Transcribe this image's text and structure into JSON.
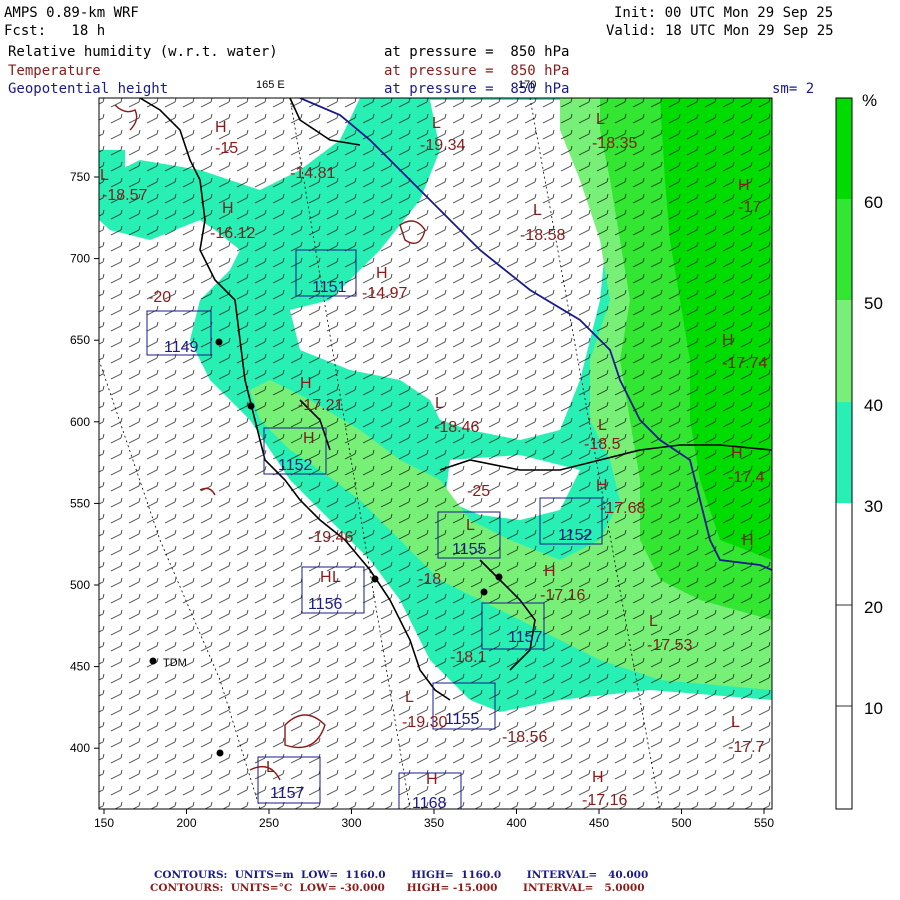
{
  "header": {
    "model": "AMPS 0.89-km WRF",
    "fcst": "Fcst:   18 h",
    "init": "Init: 00 UTC Mon 29 Sep 25",
    "valid": "Valid: 18 UTC Mon 29 Sep 25",
    "rh_label": "Relative humidity (w.r.t. water)",
    "temp_label": "Temperature",
    "geo_label": "Geopotential height",
    "pressure_1": "at pressure =  850 hPa",
    "pressure_2": "at pressure =  850 hPa",
    "pressure_3": "at pressure =  850 hPa",
    "lon_165": "165 E",
    "lon_170": "170",
    "sm": "sm= 2"
  },
  "axes": {
    "x_ticks": [
      "150",
      "200",
      "250",
      "300",
      "350",
      "400",
      "450",
      "500",
      "550"
    ],
    "y_ticks": [
      "750",
      "700",
      "650",
      "600",
      "550",
      "500",
      "450",
      "400"
    ]
  },
  "colorbar": {
    "unit": "%",
    "labels": [
      "60",
      "50",
      "40",
      "30",
      "20",
      "10"
    ],
    "colors": {
      "gt60": "#00dc00",
      "50_60": "#32e632",
      "40_50": "#78f078",
      "30_40": "#28f0b4",
      "lt30": "#ffffff"
    }
  },
  "map_labels": {
    "H_marks": [
      "H",
      "H",
      "H",
      "H",
      "H",
      "H",
      "H",
      "H",
      "H",
      "H",
      "H",
      "H",
      "H",
      "H"
    ],
    "L_marks": [
      "L",
      "L",
      "L",
      "L",
      "L",
      "L",
      "L",
      "L",
      "L",
      "L",
      "L",
      "L"
    ],
    "temps": [
      "-15",
      "-14.81",
      "-16.12",
      "-19.34",
      "-18.35",
      "-18.58",
      "-17",
      "-14.97",
      "-17.21",
      "-18.46",
      "-18.5",
      "-17.74",
      "-17.4",
      "-17.68",
      "-19.46",
      "-17.16",
      "-17.53",
      "-19.30",
      "-18.56",
      "-17.7",
      "-17.16",
      "-18.57",
      "-20",
      "-25",
      "-18",
      "-18.1"
    ],
    "heights": [
      "1151",
      "1149",
      "1152",
      "1155",
      "1152",
      "1156",
      "1157",
      "1155",
      "1157",
      "1168"
    ],
    "place": "TDM"
  },
  "footer": {
    "line1": "CONTOURS:  UNITS=m  LOW=  1160.0       HIGH=  1160.0       INTERVAL=   40.000",
    "line2": "CONTOURS:  UNITS=°C  LOW= -30.000      HIGH= -15.000       INTERVAL=   5.0000"
  }
}
